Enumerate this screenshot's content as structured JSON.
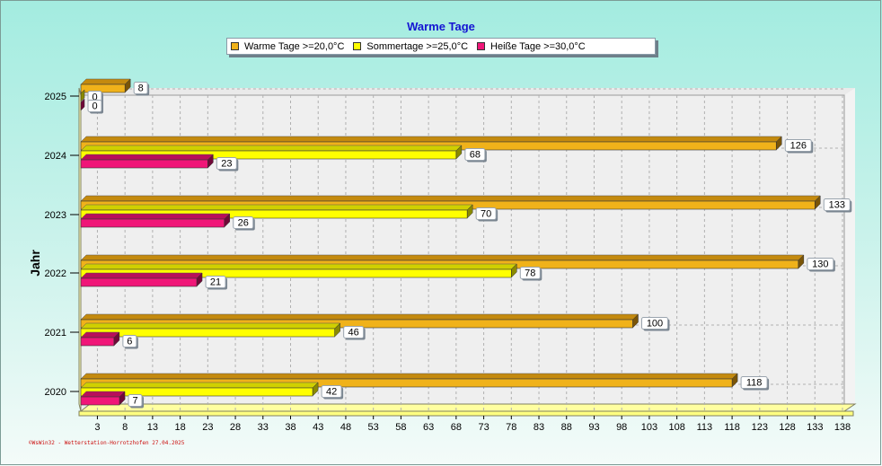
{
  "title": "Warme Tage",
  "ylabel": "Jahr",
  "credit": "©WsWin32 - Wetterstation-Horrotzhofen 27.04.2025",
  "colors": {
    "warm": "#f0b21a",
    "sommer": "#ffff00",
    "heiss": "#f01678"
  },
  "chart_data": {
    "type": "bar",
    "orientation": "horizontal",
    "title": "Warme Tage",
    "ylabel": "Jahr",
    "xlabel": "",
    "categories": [
      "2020",
      "2021",
      "2022",
      "2023",
      "2024",
      "2025"
    ],
    "series": [
      {
        "name": "Warme Tage >=20,0°C",
        "values": [
          118,
          100,
          130,
          133,
          126,
          8
        ]
      },
      {
        "name": "Sommertage >=25,0°C",
        "values": [
          42,
          46,
          78,
          70,
          68,
          0
        ]
      },
      {
        "name": "Heiße Tage >=30,0°C",
        "values": [
          7,
          6,
          21,
          26,
          23,
          0
        ]
      }
    ],
    "xticks": [
      3,
      8,
      13,
      18,
      23,
      28,
      33,
      38,
      43,
      48,
      53,
      58,
      63,
      68,
      73,
      78,
      83,
      88,
      93,
      98,
      103,
      108,
      113,
      118,
      123,
      128,
      133,
      138
    ],
    "xlim": [
      0,
      138
    ],
    "grid": true,
    "legend_position": "top"
  }
}
